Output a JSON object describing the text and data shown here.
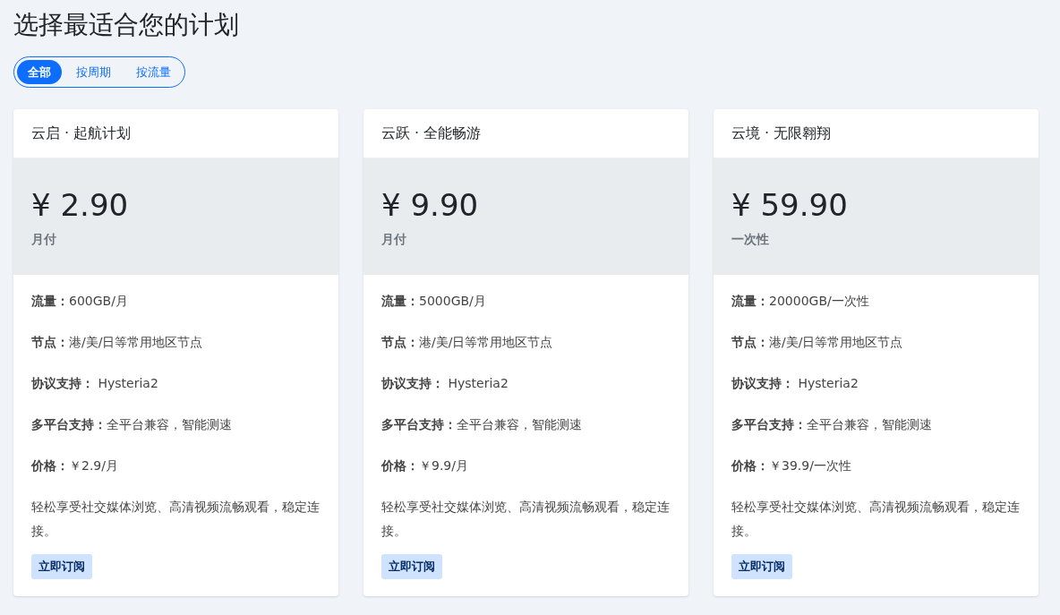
{
  "title": "选择最适合您的计划",
  "filters": [
    {
      "label": "全部",
      "selected": true
    },
    {
      "label": "按周期",
      "selected": false
    },
    {
      "label": "按流量",
      "selected": false
    }
  ],
  "plans": [
    {
      "name": "云启 · 起航计划",
      "price": "¥ 2.90",
      "period": "月付",
      "features": [
        "**流量：**600GB/月",
        "**节点：**港/美/日等常用地区节点",
        "**协议支持：** Hysteria2",
        "**多平台支持：**全平台兼容，智能测速",
        "**价格：**￥2.9/月"
      ],
      "description": "轻松享受社交媒体浏览、高清视频流畅观看，稳定连接。",
      "button": "立即订阅"
    },
    {
      "name": "云跃 · 全能畅游",
      "price": "¥ 9.90",
      "period": "月付",
      "features": [
        "**流量：**5000GB/月",
        "**节点：**港/美/日等常用地区节点",
        "**协议支持：** Hysteria2",
        "**多平台支持：**全平台兼容，智能测速",
        "**价格：**￥9.9/月"
      ],
      "description": "轻松享受社交媒体浏览、高清视频流畅观看，稳定连接。",
      "button": "立即订阅"
    },
    {
      "name": "云境 · 无限翱翔",
      "price": "¥ 59.90",
      "period": "一次性",
      "features": [
        "**流量：**20000GB/一次性",
        "**节点：**港/美/日等常用地区节点",
        "**协议支持：** Hysteria2",
        "**多平台支持：**全平台兼容，智能测速",
        "**价格：**￥39.9/一次性"
      ],
      "description": "轻松享受社交媒体浏览、高清视频流畅观看，稳定连接。",
      "button": "立即订阅"
    }
  ]
}
